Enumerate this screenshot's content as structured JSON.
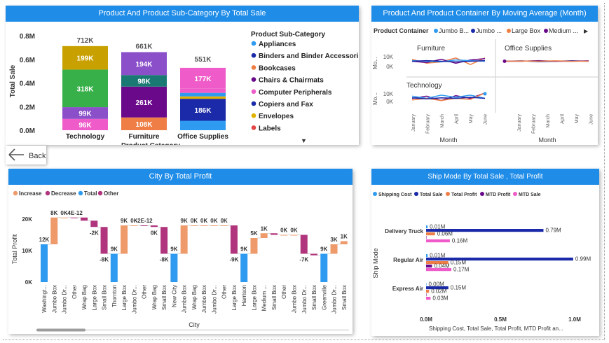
{
  "chart1": {
    "title": "Product And Product Sub-Category By Total Sale",
    "ylabel": "Total Sale",
    "xlabel": "Product Category",
    "yticks": [
      "0.8M",
      "0.6M",
      "0.4M",
      "0.2M",
      "0.0M"
    ],
    "legend_title": "Product Sub-Category",
    "legend": [
      {
        "name": "Appliances",
        "color": "#2e9bf0"
      },
      {
        "name": "Binders and Binder Accessori...",
        "color": "#1a2aa8"
      },
      {
        "name": "Bookcases",
        "color": "#ee7e45"
      },
      {
        "name": "Chairs & Chairmats",
        "color": "#6a0a8a"
      },
      {
        "name": "Computer Peripherals",
        "color": "#ef5cc9"
      },
      {
        "name": "Copiers and Fax",
        "color": "#1a2aa8"
      },
      {
        "name": "Envelopes",
        "color": "#e1b100"
      },
      {
        "name": "Labels",
        "color": "#e14545"
      }
    ],
    "more_arrow": "▼"
  },
  "chart2": {
    "title": "Product And Product Container By Moving Average (Month)",
    "legend_title": "Product Container",
    "legend": [
      {
        "name": "Jumbo B...",
        "color": "#2e9bf0"
      },
      {
        "name": "Jumbo ...",
        "color": "#1a2aa8"
      },
      {
        "name": "Large Box",
        "color": "#ee7e45"
      },
      {
        "name": "Medium ...",
        "color": "#6a0a8a"
      }
    ],
    "next_arrow": "▶",
    "panels": [
      "Furniture",
      "Office Supplies",
      "Technology"
    ],
    "ylabel": "Mo...",
    "yticks": [
      "10K",
      "0K"
    ],
    "months": [
      "January",
      "February",
      "March",
      "April",
      "May",
      "June"
    ],
    "xlabel": "Month"
  },
  "back": {
    "label": "Back"
  },
  "chart3": {
    "title": "City By Total Profit",
    "legend": [
      {
        "name": "Increase",
        "color": "#ee9a6b"
      },
      {
        "name": "Decrease",
        "color": "#b0357d"
      },
      {
        "name": "Total",
        "color": "#2e9bf0"
      },
      {
        "name": "Other",
        "color": "#b0357d"
      }
    ],
    "ylabel": "Total Profit",
    "yticks": [
      "20K",
      "10K",
      "0K"
    ],
    "xlabel": "City",
    "categories": [
      "Washingt...",
      "Jumbo Box",
      "Jumbo Dr...",
      "Other",
      "Wrap Bag",
      "Large Box",
      "Small Box",
      "Thornton",
      "Large Box",
      "Jumbo Dr...",
      "Other",
      "Wrap Bag",
      "Small Box",
      "New City",
      "Jumbo Box",
      "Wrap Bag",
      "Jumbo Box",
      "Jumbo Dr...",
      "Other",
      "Large Box",
      "Harrison",
      "Large Box",
      "Medium ...",
      "Small Box",
      "Other",
      "Jumbo Box",
      "Jumbo Dr...",
      "Small Box",
      "Greenville",
      "Jumbo Dr...",
      "Small Box"
    ],
    "data_labels": [
      "12K",
      "8K",
      "0K",
      "-4E-12",
      "",
      "-2K",
      "-8K",
      "9K",
      "9K",
      "0K",
      "-2E-12",
      "0K",
      "-8K",
      "9K",
      "9K",
      "0K",
      "0K",
      "0K",
      "0K",
      "-9K",
      "9K",
      "5K",
      "1K",
      "",
      "0K",
      "0K",
      "-7K",
      "",
      "9K",
      "3K",
      "1K"
    ]
  },
  "chart4": {
    "title": "Ship Mode By Total Sale , Total Profit",
    "legend": [
      {
        "name": "Shipping Cost",
        "color": "#2e9bf0"
      },
      {
        "name": "Total Sale",
        "color": "#1a2aa8"
      },
      {
        "name": "Total Profit",
        "color": "#ee7e45"
      },
      {
        "name": "MTD Profit",
        "color": "#6a0a8a"
      },
      {
        "name": "MTD Sale",
        "color": "#ef5cc9"
      }
    ],
    "ylabel": "Ship Mode",
    "xticks": [
      "0.0M",
      "0.5M",
      "1.0M"
    ],
    "xlabel": "Shipping Cost, Total Sale, Total Profit, MTD Profit an...",
    "groups": [
      {
        "name": "Delivery Truck",
        "labels": [
          "0.01M",
          "0.79M",
          "0.06M",
          "",
          "0.16M"
        ]
      },
      {
        "name": "Regular Air",
        "labels": [
          "0.01M",
          "0.99M",
          "0.15M",
          "0.04M",
          "0.17M"
        ]
      },
      {
        "name": "Express Air",
        "labels": [
          "0.00M",
          "0.15M",
          "0.02M",
          "",
          "0.03M"
        ]
      }
    ]
  },
  "chart_data": [
    {
      "type": "bar",
      "stacked": true,
      "title": "Product And Product Sub-Category By Total Sale",
      "xlabel": "Product Category",
      "ylabel": "Total Sale",
      "ylim": [
        0,
        800000
      ],
      "categories": [
        "Technology",
        "Furniture",
        "Office Supplies"
      ],
      "totals": [
        712000,
        661000,
        551000
      ],
      "total_labels": [
        "712K",
        "661K",
        "551K"
      ],
      "segments": [
        [
          {
            "v": 96000,
            "label": "96K",
            "color": "#ef5cc9"
          },
          {
            "v": 99000,
            "label": "99K",
            "color": "#8a4fc9"
          },
          {
            "v": 318000,
            "label": "318K",
            "color": "#37b049"
          },
          {
            "v": 199000,
            "label": "199K",
            "color": "#c8a000"
          }
        ],
        [
          {
            "v": 108000,
            "label": "108K",
            "color": "#ee7e45"
          },
          {
            "v": 261000,
            "label": "261K",
            "color": "#6a0a8a"
          },
          {
            "v": 98000,
            "label": "98K",
            "color": "#1a7a73"
          },
          {
            "v": 194000,
            "label": "194K",
            "color": "#8a4fc9"
          }
        ],
        [
          {
            "v": 80000,
            "label": "",
            "color": "#2e9bf0"
          },
          {
            "v": 186000,
            "label": "186K",
            "color": "#1a2aa8"
          },
          {
            "v": 20000,
            "label": "",
            "color": "#e1b100"
          },
          {
            "v": 30000,
            "label": "",
            "color": "#2e9bf0"
          },
          {
            "v": 35000,
            "label": "",
            "color": "#ef5cc9"
          },
          {
            "v": 177000,
            "label": "177K",
            "color": "#ef5cc9"
          }
        ]
      ]
    },
    {
      "type": "line",
      "title": "Product And Product Container By Moving Average (Month)",
      "x": [
        "January",
        "February",
        "March",
        "April",
        "May",
        "June"
      ],
      "panels": [
        {
          "name": "Furniture",
          "series": [
            {
              "color": "#ee7e45",
              "values": [
                1500,
                -1500,
                -500,
                2500,
                -2500,
                2500
              ]
            },
            {
              "color": "#6a0a8a",
              "values": [
                0,
                -1000,
                1500,
                -1500,
                1000,
                2000
              ]
            },
            {
              "color": "#2e9bf0",
              "values": [
                500,
                0,
                -500,
                1000,
                500,
                0
              ]
            },
            {
              "color": "#1a2aa8",
              "values": [
                0,
                500,
                0,
                -500,
                0,
                500
              ]
            }
          ]
        },
        {
          "name": "Office Supplies",
          "series": [
            {
              "color": "#1a2aa8",
              "values": [
                0,
                300,
                -300,
                0,
                400,
                0
              ]
            },
            {
              "color": "#6a0a8a",
              "values": [
                0,
                0,
                500,
                0,
                0,
                300
              ]
            },
            {
              "color": "#ee7e45",
              "values": [
                0,
                200,
                0,
                300,
                0,
                0
              ]
            }
          ]
        },
        {
          "name": "Technology",
          "series": [
            {
              "color": "#6a0a8a",
              "values": [
                0,
                2000,
                -2000,
                2500,
                0,
                5000
              ]
            },
            {
              "color": "#2e9bf0",
              "values": [
                2000,
                0,
                3000,
                1000,
                3000,
                0
              ]
            },
            {
              "color": "#ee7e45",
              "values": [
                -1500,
                0,
                -2000,
                0,
                -1000,
                5000
              ]
            },
            {
              "color": "#1a2aa8",
              "values": [
                500,
                -500,
                500,
                0,
                1000,
                0
              ]
            }
          ]
        }
      ]
    },
    {
      "type": "waterfall",
      "title": "City By Total Profit",
      "xlabel": "City",
      "ylabel": "Total Profit",
      "ylim": [
        0,
        20000
      ],
      "bars": [
        {
          "kind": "total",
          "from": 0,
          "to": 12000
        },
        {
          "kind": "increase",
          "from": 12000,
          "to": 20500
        },
        {
          "kind": "increase",
          "from": 20500,
          "to": 20500
        },
        {
          "kind": "decrease",
          "from": 20500,
          "to": 20500
        },
        {
          "kind": "decrease",
          "from": 20500,
          "to": 19500
        },
        {
          "kind": "decrease",
          "from": 19500,
          "to": 17500
        },
        {
          "kind": "decrease",
          "from": 17500,
          "to": 9000
        },
        {
          "kind": "total",
          "from": 0,
          "to": 9000
        },
        {
          "kind": "increase",
          "from": 9000,
          "to": 18000
        },
        {
          "kind": "increase",
          "from": 18000,
          "to": 18000
        },
        {
          "kind": "decrease",
          "from": 18000,
          "to": 18000
        },
        {
          "kind": "decrease",
          "from": 18000,
          "to": 17500
        },
        {
          "kind": "decrease",
          "from": 17500,
          "to": 9000
        },
        {
          "kind": "total",
          "from": 0,
          "to": 9000
        },
        {
          "kind": "increase",
          "from": 9000,
          "to": 18000
        },
        {
          "kind": "increase",
          "from": 18000,
          "to": 18000
        },
        {
          "kind": "increase",
          "from": 18000,
          "to": 18000
        },
        {
          "kind": "increase",
          "from": 18000,
          "to": 18000
        },
        {
          "kind": "increase",
          "from": 18000,
          "to": 18000
        },
        {
          "kind": "decrease",
          "from": 18000,
          "to": 9000
        },
        {
          "kind": "total",
          "from": 0,
          "to": 9000
        },
        {
          "kind": "increase",
          "from": 9000,
          "to": 14000
        },
        {
          "kind": "increase",
          "from": 14000,
          "to": 15500
        },
        {
          "kind": "decrease",
          "from": 15500,
          "to": 15000
        },
        {
          "kind": "increase",
          "from": 15000,
          "to": 15000
        },
        {
          "kind": "increase",
          "from": 15000,
          "to": 15000
        },
        {
          "kind": "decrease",
          "from": 15000,
          "to": 9000
        },
        {
          "kind": "decrease",
          "from": 9000,
          "to": 8500
        },
        {
          "kind": "total",
          "from": 0,
          "to": 9000
        },
        {
          "kind": "increase",
          "from": 9000,
          "to": 12000
        },
        {
          "kind": "increase",
          "from": 12000,
          "to": 13000
        }
      ]
    },
    {
      "type": "bar",
      "orientation": "horizontal",
      "title": "Ship Mode By Total Sale , Total Profit",
      "xlim": [
        0,
        1000000
      ],
      "categories": [
        "Delivery Truck",
        "Regular Air",
        "Express Air"
      ],
      "series": [
        {
          "name": "Shipping Cost",
          "values": [
            10000,
            10000,
            0
          ]
        },
        {
          "name": "Total Sale",
          "values": [
            790000,
            990000,
            150000
          ]
        },
        {
          "name": "Total Profit",
          "values": [
            60000,
            150000,
            20000
          ]
        },
        {
          "name": "MTD Profit",
          "values": [
            0,
            40000,
            0
          ]
        },
        {
          "name": "MTD Sale",
          "values": [
            160000,
            170000,
            30000
          ]
        }
      ]
    }
  ]
}
